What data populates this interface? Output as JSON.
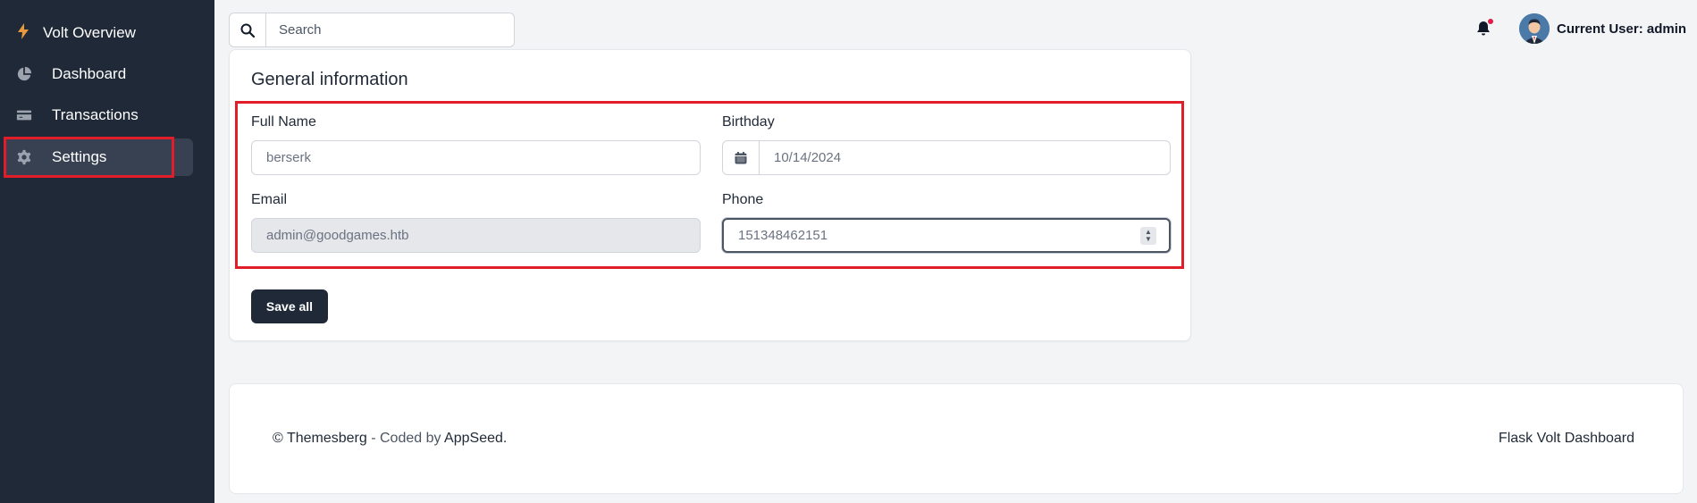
{
  "sidebar": {
    "brand": "Volt Overview",
    "items": [
      {
        "label": "Dashboard",
        "icon": "pie-chart-icon"
      },
      {
        "label": "Transactions",
        "icon": "credit-card-icon"
      },
      {
        "label": "Settings",
        "icon": "gear-icon",
        "active": true
      }
    ]
  },
  "topbar": {
    "search_placeholder": "Search",
    "user_label": "Current User: admin"
  },
  "card": {
    "title": "General information",
    "fields": {
      "full_name": {
        "label": "Full Name",
        "value": "berserk"
      },
      "birthday": {
        "label": "Birthday",
        "value": "10/14/2024"
      },
      "email": {
        "label": "Email",
        "value": "admin@goodgames.htb"
      },
      "phone": {
        "label": "Phone",
        "value": "151348462151"
      }
    },
    "save_label": "Save all"
  },
  "footer": {
    "copyright_prefix": "© Themesberg",
    "coded_by": " - Coded by ",
    "author": "AppSeed.",
    "product": "Flask Volt Dashboard"
  },
  "colors": {
    "sidebar_bg": "#1f2937",
    "highlight": "#e11d2a",
    "notification_dot": "#e11d48",
    "brand_bolt": "#e89a3c"
  }
}
